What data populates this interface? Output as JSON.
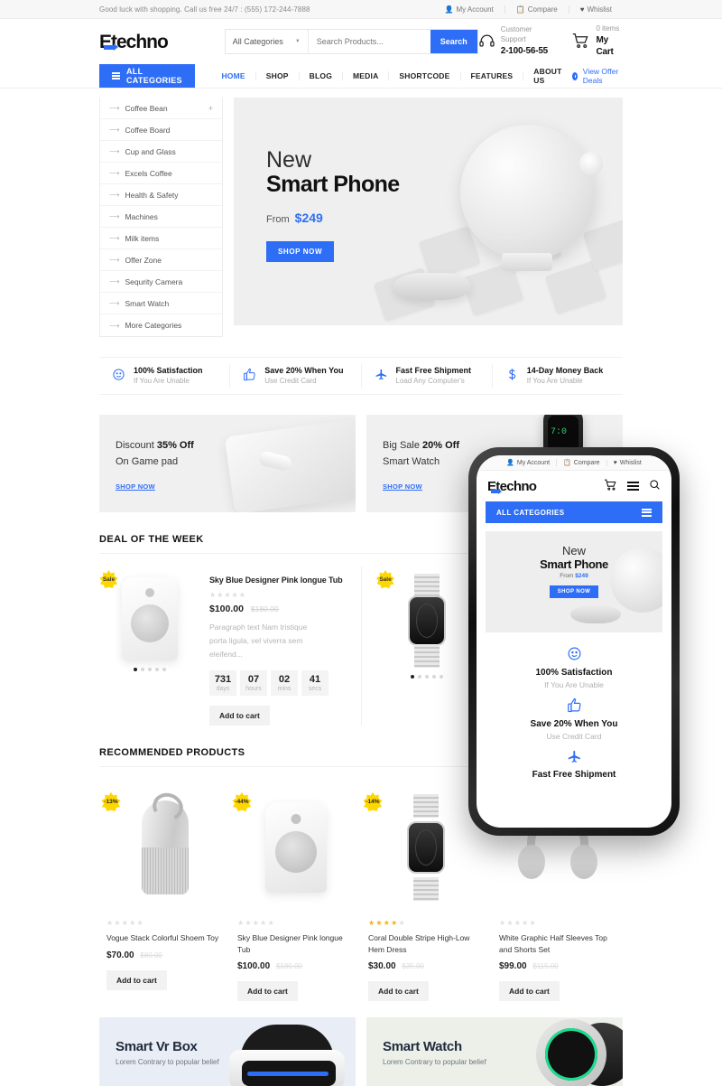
{
  "topbar": {
    "message": "Good luck with shopping. Call us free 24/7 : (555) 172-244-7888",
    "links": [
      {
        "label": "My Account",
        "icon": "user-icon"
      },
      {
        "label": "Compare",
        "icon": "compare-icon"
      },
      {
        "label": "Whislist",
        "icon": "heart-icon"
      }
    ]
  },
  "header": {
    "logo": "Etechno",
    "search": {
      "category": "All Categories",
      "placeholder": "Search Products...",
      "button": "Search"
    },
    "support": {
      "label": "Customer Support",
      "phone": "2-100-56-55"
    },
    "cart": {
      "count": "0 items",
      "label": "My Cart"
    }
  },
  "nav": {
    "all_categories": "ALL CATEGORIES",
    "links": [
      "HOME",
      "SHOP",
      "BLOG",
      "MEDIA",
      "SHORTCODE",
      "FEATURES",
      "ABOUT US"
    ],
    "active": "HOME",
    "offer": "View Offer Deals"
  },
  "categories": [
    {
      "label": "Coffee Bean",
      "expandable": "+"
    },
    {
      "label": "Coffee Board"
    },
    {
      "label": "Cup and Glass"
    },
    {
      "label": "Excels Coffee"
    },
    {
      "label": "Health & Safety"
    },
    {
      "label": "Machines"
    },
    {
      "label": "Milk items"
    },
    {
      "label": "Offer Zone"
    },
    {
      "label": "Sequrity Camera"
    },
    {
      "label": "Smart Watch"
    },
    {
      "label": "More Categories"
    }
  ],
  "hero": {
    "eyebrow": "New",
    "title": "Smart Phone",
    "from_label": "From",
    "price": "$249",
    "button": "SHOP NOW"
  },
  "features": [
    {
      "icon": "smiley-icon",
      "title": "100% Satisfaction",
      "sub": "If You Are Unable"
    },
    {
      "icon": "thumbs-up-icon",
      "title": "Save 20% When You",
      "sub": "Use Credit Card"
    },
    {
      "icon": "plane-icon",
      "title": "Fast Free Shipment",
      "sub": "Load Any Computer's"
    },
    {
      "icon": "dollar-icon",
      "title": "14-Day Money Back",
      "sub": "If You Are Unable"
    }
  ],
  "promos": [
    {
      "line1_pre": "Discount ",
      "line1_strong": "35% Off",
      "line2": "On Game pad",
      "link": "SHOP NOW"
    },
    {
      "line1_pre": "Big Sale ",
      "line1_strong": "20% Off",
      "line2": "Smart Watch",
      "link": "SHOP NOW"
    }
  ],
  "deal_section": {
    "title": "DEAL OF THE WEEK",
    "deals": [
      {
        "badge": "Sale",
        "name": "Sky Blue Designer Pink longue Tub",
        "stars": 0,
        "price": "$100.00",
        "price_old": "$180.00",
        "desc": "Paragraph text Nam tristique porta ligula, vel viverra sem eleifend...",
        "countdown": [
          {
            "num": "731",
            "label": "days"
          },
          {
            "num": "07",
            "label": "hours"
          },
          {
            "num": "02",
            "label": "mins"
          },
          {
            "num": "41",
            "label": "secs"
          }
        ],
        "button": "Add to cart"
      },
      {
        "badge": "Sale"
      }
    ]
  },
  "recommended": {
    "title": "RECOMMENDED PRODUCTS",
    "products": [
      {
        "badge": "-13%",
        "stars": 0,
        "name": "Vogue Stack Colorful Shoem Toy",
        "price": "$70.00",
        "price_old": "$80.00",
        "button": "Add to cart"
      },
      {
        "badge": "-44%",
        "stars": 0,
        "name": "Sky Blue Designer Pink longue Tub",
        "price": "$100.00",
        "price_old": "$180.00",
        "button": "Add to cart"
      },
      {
        "badge": "-14%",
        "stars": 4,
        "name": "Coral Double Stripe High-Low Hem Dress",
        "price": "$30.00",
        "price_old": "$35.00",
        "button": "Add to cart"
      },
      {
        "badge": "",
        "stars": 0,
        "name": "White Graphic Half Sleeves Top and Shorts Set",
        "price": "$99.00",
        "price_old": "$115.00",
        "button": "Add to cart"
      }
    ]
  },
  "bottom_banners": [
    {
      "title": "Smart Vr Box",
      "sub": "Lorem Contrary to popular belief"
    },
    {
      "title": "Smart Watch",
      "sub": "Lorem Contrary to popular belief"
    }
  ],
  "phone": {
    "topbar": [
      {
        "label": "My Account"
      },
      {
        "label": "Compare"
      },
      {
        "label": "Whislist"
      }
    ],
    "logo": "Etechno",
    "all_categories": "ALL CATEGORIES",
    "hero": {
      "eyebrow": "New",
      "title": "Smart Phone",
      "from_label": "From",
      "price": "$249",
      "button": "SHOP NOW"
    },
    "features": [
      {
        "icon": "smiley-icon",
        "title": "100% Satisfaction",
        "sub": "If You Are Unable"
      },
      {
        "icon": "thumbs-up-icon",
        "title": "Save 20% When You",
        "sub": "Use Credit Card"
      },
      {
        "icon": "plane-icon",
        "title": "Fast Free Shipment",
        "sub": ""
      }
    ]
  },
  "colors": {
    "accent": "#2e6ef7",
    "badge": "#ffd700",
    "star": "#f2b01e"
  }
}
